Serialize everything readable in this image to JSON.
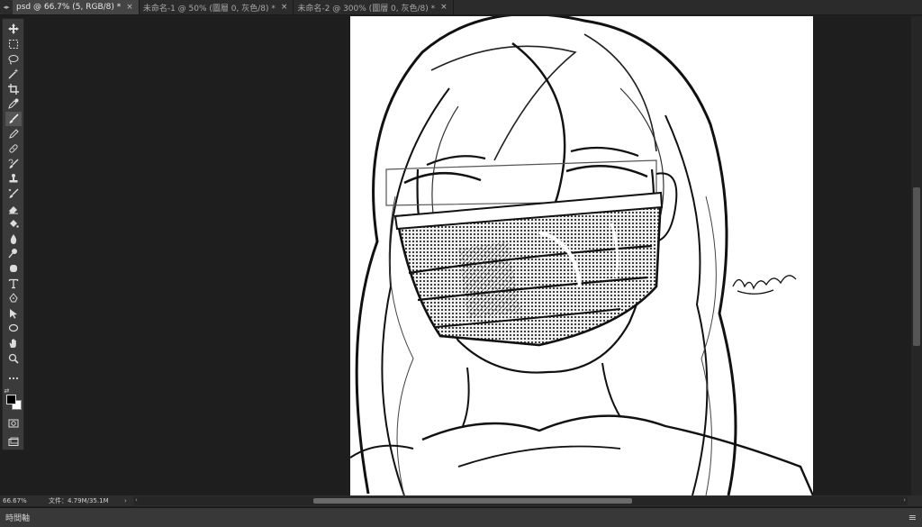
{
  "tabs": [
    {
      "label": "psd @ 66.7% (5, RGB/8) *",
      "active": true
    },
    {
      "label": "未命名-1 @ 50% (圖層 0, 灰色/8) *",
      "active": false
    },
    {
      "label": "未命名-2 @ 300% (圖層 0, 灰色/8) *",
      "active": false
    }
  ],
  "tab_close_glyph": "×",
  "tab_collapse_glyph": "◂▸",
  "tools": [
    "move-tool-icon",
    "marquee-tool-icon",
    "lasso-tool-icon",
    "magic-wand-icon",
    "crop-tool-icon",
    "eyedropper-icon",
    "spot-healing-icon",
    "brush-tool-icon",
    "clone-stamp-icon",
    "history-brush-icon",
    "eraser-icon",
    "paint-bucket-icon",
    "blur-tool-icon",
    "dodge-tool-icon",
    "pen-tool-icon",
    "type-tool-icon",
    "path-selection-icon",
    "ellipse-tool-icon",
    "hand-tool-icon",
    "zoom-tool-icon",
    "more-tools-icon"
  ],
  "status": {
    "zoom": "66.67%",
    "doc_info": "文件：4.79M/35.1M",
    "arrow": "›"
  },
  "timeline": {
    "label": "時間軸",
    "menu": "≡"
  },
  "colors": {
    "foreground": "#000000",
    "background": "#ffffff"
  }
}
